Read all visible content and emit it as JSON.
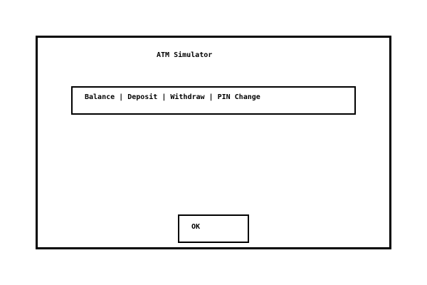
{
  "window": {
    "title": "ATM Simulator"
  },
  "menu": {
    "items": [
      {
        "label": "Balance"
      },
      {
        "label": "Deposit"
      },
      {
        "label": "Withdraw"
      },
      {
        "label": "PIN Change"
      }
    ],
    "separator": "|"
  },
  "buttons": {
    "ok_label": "OK"
  }
}
